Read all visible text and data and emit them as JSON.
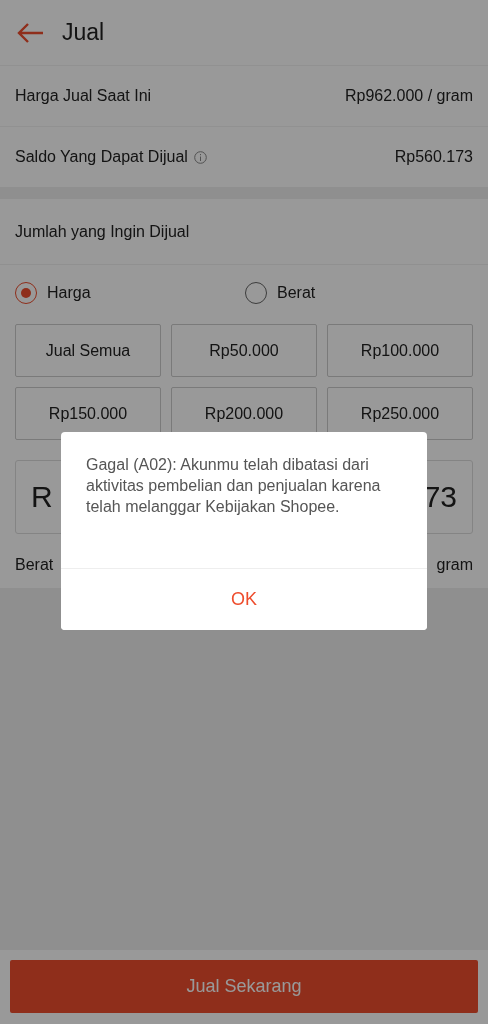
{
  "header": {
    "title": "Jual"
  },
  "info_rows": [
    {
      "label": "Harga Jual Saat Ini",
      "value": "Rp962.000 / gram",
      "info_icon": false
    },
    {
      "label": "Saldo Yang Dapat Dijual",
      "value": "Rp560.173",
      "info_icon": true
    }
  ],
  "amount_section": {
    "title": "Jumlah yang Ingin Dijual",
    "options": [
      {
        "label": "Harga",
        "selected": true
      },
      {
        "label": "Berat",
        "selected": false
      }
    ],
    "presets": [
      "Jual Semua",
      "Rp50.000",
      "Rp100.000",
      "Rp150.000",
      "Rp200.000",
      "Rp250.000"
    ],
    "amount_field": {
      "prefix": "R",
      "value_end": "73"
    },
    "weight_row": {
      "label": "Berat",
      "unit": "gram"
    }
  },
  "submit_button": "Jual Sekarang",
  "dialog": {
    "message": "Gagal (A02): Akunmu telah dibatasi dari aktivitas pembelian dan penjualan karena telah melanggar Kebijakan Shopee.",
    "button": "OK"
  }
}
